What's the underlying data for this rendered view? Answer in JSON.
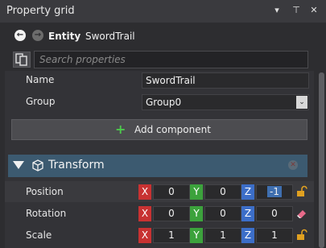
{
  "title_bar": {
    "title": "Property grid",
    "dropdown_glyph": "▾",
    "pin_glyph": "⊤",
    "close_glyph": "✕"
  },
  "nav": {
    "back_glyph": "←",
    "forward_glyph": "→",
    "entity_label": "Entity",
    "entity_name": "SwordTrail"
  },
  "search": {
    "placeholder": "Search properties",
    "value": ""
  },
  "properties": {
    "name": {
      "label": "Name",
      "value": "SwordTrail"
    },
    "group": {
      "label": "Group",
      "value": "Group0",
      "arrow": "⌄"
    }
  },
  "add_component": {
    "plus": "+",
    "label": "Add component"
  },
  "transform": {
    "title": "Transform",
    "remove_glyph": "✕",
    "position": {
      "label": "Position",
      "x": "0",
      "y": "0",
      "z": "-1"
    },
    "rotation": {
      "label": "Rotation",
      "x": "0",
      "y": "0",
      "z": "0"
    },
    "scale": {
      "label": "Scale",
      "x": "1",
      "y": "1",
      "z": "1"
    },
    "axis_labels": {
      "x": "X",
      "y": "Y",
      "z": "Z"
    }
  },
  "colors": {
    "axis_x": "#c83232",
    "axis_y": "#3ca23c",
    "axis_z": "#3c6ec8",
    "transform_header": "#3c5a70",
    "add_plus": "#4cc94c"
  }
}
